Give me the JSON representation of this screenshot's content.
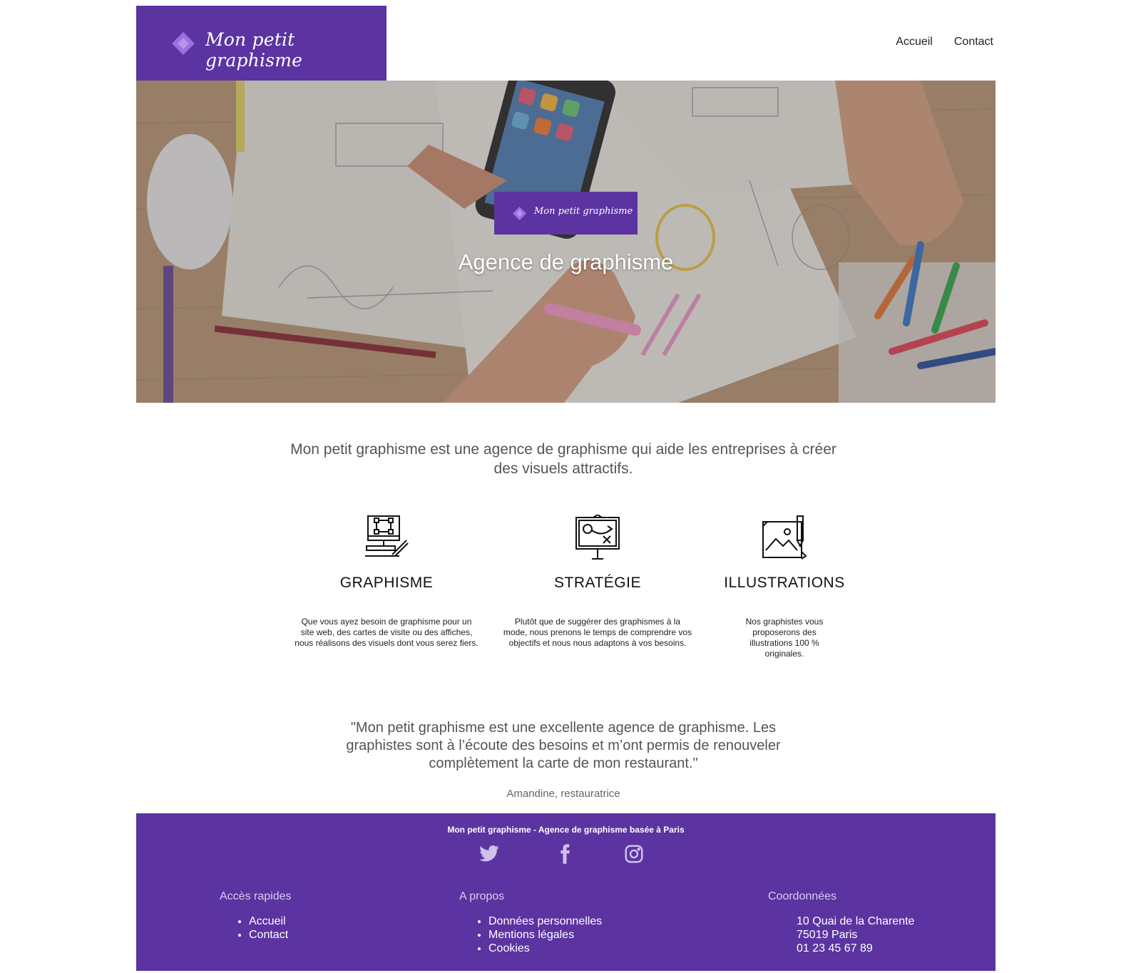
{
  "brand": {
    "name": "Mon petit graphisme",
    "accent_color": "#5b34a1",
    "diamond_color": "#9a6fe0"
  },
  "nav": {
    "items": [
      "Accueil",
      "Contact"
    ]
  },
  "hero": {
    "badge_text": "Mon petit graphisme",
    "title": "Agence de graphisme"
  },
  "intro": {
    "text": "Mon petit graphisme est une agence de graphisme qui aide les entreprises à créer des visuels attractifs."
  },
  "services": [
    {
      "icon": "design-monitor-icon",
      "title": "GRAPHISME",
      "text": "Que vous ayez besoin de graphisme pour un site web, des cartes de visite ou des affiches, nous réalisons des visuels dont vous serez fiers."
    },
    {
      "icon": "strategy-board-icon",
      "title": "STRATÉGIE",
      "text": "Plutôt que de suggérer des graphismes à la mode, nous prenons le temps de comprendre vos objectifs et nous nous adaptons à vos besoins."
    },
    {
      "icon": "illustration-canvas-icon",
      "title": "ILLUSTRATIONS",
      "text": "Nos graphistes vous proposerons des illustrations 100 % originales."
    }
  ],
  "testimonial": {
    "quote": "\"Mon petit graphisme est une excellente agence de graphisme. Les graphistes sont à l’écoute des besoins et m’ont permis de renouveler complètement la carte de mon restaurant.\"",
    "author": "Amandine, restauratrice"
  },
  "footer": {
    "tagline": "Mon petit graphisme - Agence de graphisme basée à Paris",
    "social": [
      "twitter-icon",
      "facebook-icon",
      "instagram-icon"
    ],
    "quick_links": {
      "title": "Accès rapides",
      "items": [
        "Accueil",
        "Contact"
      ]
    },
    "about": {
      "title": "A propos",
      "items": [
        "Données personnelles",
        "Mentions légales",
        "Cookies"
      ]
    },
    "contact": {
      "title": "Coordonnées",
      "street": "10 Quai de la Charente",
      "city": "75019 Paris",
      "phone": "01 23 45 67 89"
    }
  }
}
